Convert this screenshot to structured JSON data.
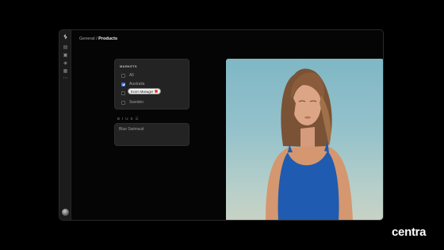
{
  "breadcrumb": {
    "parent": "General",
    "separator": "/",
    "current": "Products"
  },
  "rail": {
    "logo_icon": "centra-logo-icon",
    "items": [
      {
        "icon": "grid-icon",
        "glyph": "▤"
      },
      {
        "icon": "box-icon",
        "glyph": "▣"
      },
      {
        "icon": "tag-icon",
        "glyph": "◈"
      },
      {
        "icon": "list-icon",
        "glyph": "▦"
      },
      {
        "icon": "more-icon",
        "glyph": "⋯"
      }
    ]
  },
  "markets": {
    "heading": "MARKETS",
    "options": [
      {
        "label": "All",
        "checked": false
      },
      {
        "label": "Australia",
        "checked": true
      },
      {
        "label": "",
        "checked": false
      },
      {
        "label": "Sweden",
        "checked": false
      }
    ],
    "collaborator_chip": {
      "label": "Ecom Manager",
      "dot_color": "#e0452f"
    }
  },
  "toolbar": {
    "bold": "B",
    "italic": "I",
    "underline": "U",
    "strike": "S",
    "list": "☰"
  },
  "description": {
    "value": "Blue Swimsuit"
  },
  "brand": {
    "name": "centra"
  },
  "colors": {
    "accent": "#3c6fe8",
    "background": "#000000",
    "panel": "#232323"
  }
}
